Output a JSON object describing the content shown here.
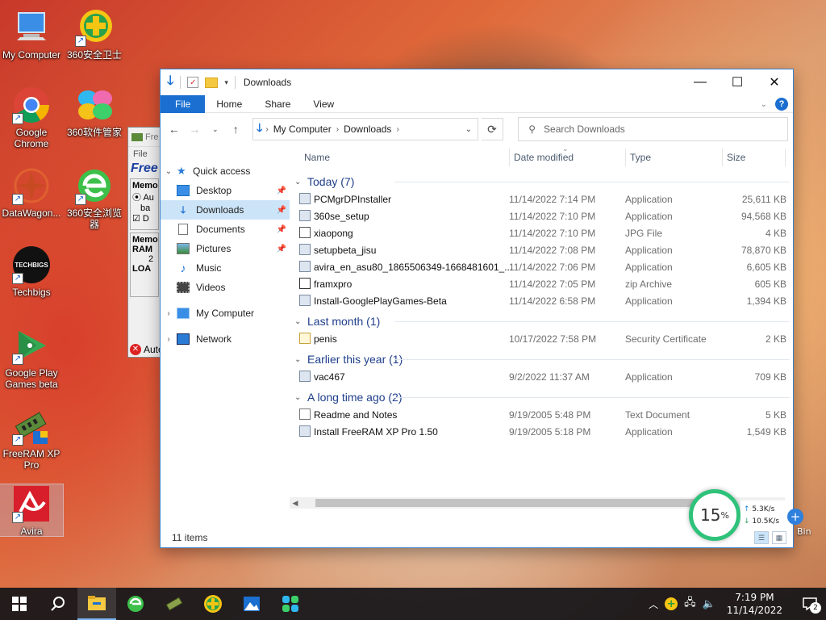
{
  "desktop": {
    "icons": [
      {
        "label": "My Computer",
        "icon": "computer-icon"
      },
      {
        "label": "360安全卫士",
        "icon": "360-security-icon"
      },
      {
        "label": "Google Chrome",
        "icon": "chrome-icon"
      },
      {
        "label": "360软件管家",
        "icon": "360-software-manager-icon"
      },
      {
        "label": "DataWagon...",
        "icon": "datawagon-icon"
      },
      {
        "label": "360安全浏览器",
        "icon": "360-browser-icon"
      },
      {
        "label": "Techbigs",
        "icon": "techbigs-icon",
        "logo_text": "TECHBIGS"
      },
      {
        "label": "Google Play Games beta",
        "icon": "google-play-games-icon"
      },
      {
        "label": "FreeRAM XP Pro",
        "icon": "freeram-icon"
      },
      {
        "label": "Avira",
        "icon": "avira-icon"
      }
    ],
    "bin_label": "Bin"
  },
  "background_window": {
    "title": "Fre",
    "menu": "File",
    "brand": "Free",
    "group1_title": "Memo",
    "group1_line1": "Au",
    "group1_line2": "ba",
    "group1_check": "D",
    "group2_title": "Memo",
    "group2_line1": "RAM",
    "group2_line2": "2",
    "group2_line3": "LOA",
    "auto_label": "Auto"
  },
  "explorer": {
    "title": "Downloads",
    "ribbon_tabs": [
      "File",
      "Home",
      "Share",
      "View"
    ],
    "help_label": "?",
    "address": {
      "segments": [
        "My Computer",
        "Downloads"
      ]
    },
    "search_placeholder": "Search Downloads",
    "nav": {
      "quick_access": "Quick access",
      "items": [
        {
          "label": "Desktop",
          "icon": "desktop-folder-icon",
          "pinned": true
        },
        {
          "label": "Downloads",
          "icon": "downloads-folder-icon",
          "pinned": true,
          "selected": true
        },
        {
          "label": "Documents",
          "icon": "documents-folder-icon",
          "pinned": true
        },
        {
          "label": "Pictures",
          "icon": "pictures-folder-icon",
          "pinned": true
        },
        {
          "label": "Music",
          "icon": "music-folder-icon",
          "pinned": false
        },
        {
          "label": "Videos",
          "icon": "videos-folder-icon",
          "pinned": false
        }
      ],
      "my_computer": "My Computer",
      "network": "Network"
    },
    "columns": {
      "name": "Name",
      "date": "Date modified",
      "type": "Type",
      "size": "Size"
    },
    "groups": [
      {
        "label": "Today (7)",
        "files": [
          {
            "name": "PCMgrDPInstaller",
            "date": "11/14/2022 7:14 PM",
            "type": "Application",
            "size": "25,611 KB"
          },
          {
            "name": "360se_setup",
            "date": "11/14/2022 7:10 PM",
            "type": "Application",
            "size": "94,568 KB"
          },
          {
            "name": "xiaopong",
            "date": "11/14/2022 7:10 PM",
            "type": "JPG File",
            "size": "4 KB"
          },
          {
            "name": "setupbeta_jisu",
            "date": "11/14/2022 7:08 PM",
            "type": "Application",
            "size": "78,870 KB"
          },
          {
            "name": "avira_en_asu80_1865506349-1668481601_...",
            "date": "11/14/2022 7:06 PM",
            "type": "Application",
            "size": "6,605 KB"
          },
          {
            "name": "framxpro",
            "date": "11/14/2022 7:05 PM",
            "type": "zip Archive",
            "size": "605 KB"
          },
          {
            "name": "Install-GooglePlayGames-Beta",
            "date": "11/14/2022 6:58 PM",
            "type": "Application",
            "size": "1,394 KB"
          }
        ]
      },
      {
        "label": "Last month (1)",
        "files": [
          {
            "name": "penis",
            "date": "10/17/2022 7:58 PM",
            "type": "Security Certificate",
            "size": "2 KB"
          }
        ]
      },
      {
        "label": "Earlier this year (1)",
        "files": [
          {
            "name": "vac467",
            "date": "9/2/2022 11:37 AM",
            "type": "Application",
            "size": "709 KB"
          }
        ]
      },
      {
        "label": "A long time ago (2)",
        "files": [
          {
            "name": "Readme and Notes",
            "date": "9/19/2005 5:48 PM",
            "type": "Text Document",
            "size": "5 KB"
          },
          {
            "name": "Install FreeRAM XP Pro 1.50",
            "date": "9/19/2005 5:18 PM",
            "type": "Application",
            "size": "1,549 KB"
          }
        ]
      }
    ],
    "status": "11 items"
  },
  "net_widget": {
    "percent": "15",
    "percent_unit": "%",
    "up_speed": "5.3K/s",
    "down_speed": "10.5K/s",
    "ring_color": "#2fc27a"
  },
  "taskbar": {
    "time": "7:19 PM",
    "date": "11/14/2022",
    "notification_count": "2"
  },
  "colors": {
    "accent": "#1a6fd0",
    "selection": "#cce4f7",
    "group_header": "#1e3e8a"
  }
}
